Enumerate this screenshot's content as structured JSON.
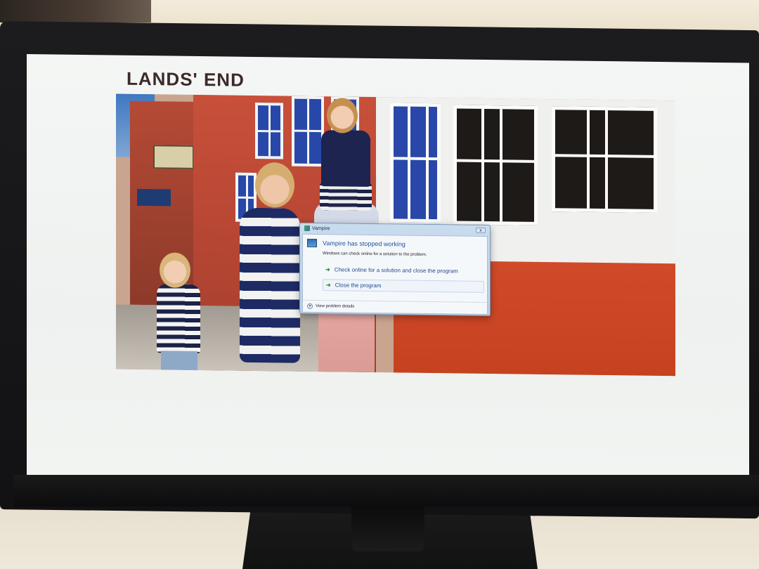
{
  "site": {
    "logo_text": "LANDS' END"
  },
  "error_dialog": {
    "window_title": "Vampire",
    "close_label": "x",
    "heading": "Vampire has stopped working",
    "description": "Windows can check online for a solution to the problem.",
    "options": [
      {
        "label": "Check online for a solution and close the program",
        "icon": "green-arrow-icon"
      },
      {
        "label": "Close the program",
        "icon": "green-arrow-icon"
      }
    ],
    "details_label": "View problem details",
    "details_icon": "chevron-down-icon"
  },
  "colors": {
    "logo": "#3c2a2b",
    "dialog_heading": "#1f4e9c",
    "dialog_frame": "#b7cfe6",
    "option_arrow": "#2e8b3a"
  }
}
